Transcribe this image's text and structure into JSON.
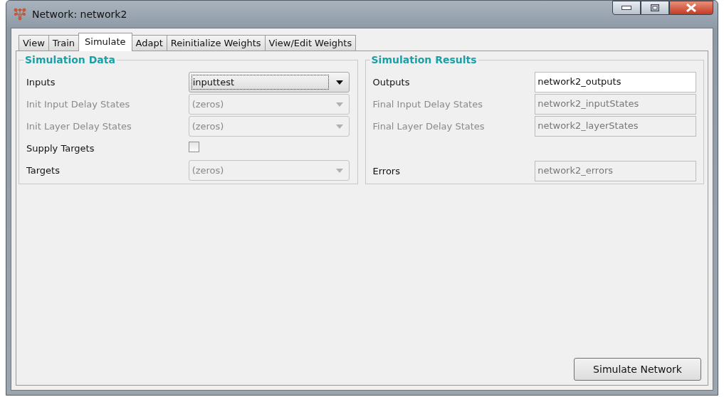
{
  "window": {
    "title": "Network: network2"
  },
  "tabs": [
    {
      "label": "View",
      "selected": false
    },
    {
      "label": "Train",
      "selected": false
    },
    {
      "label": "Simulate",
      "selected": true
    },
    {
      "label": "Adapt",
      "selected": false
    },
    {
      "label": "Reinitialize Weights",
      "selected": false
    },
    {
      "label": "View/Edit Weights",
      "selected": false
    }
  ],
  "simulation_data": {
    "title": "Simulation Data",
    "rows": [
      {
        "kind": "dropdown",
        "label": "Inputs",
        "label_disabled": false,
        "value": "inputtest",
        "disabled": false
      },
      {
        "kind": "dropdown",
        "label": "Init Input Delay States",
        "label_disabled": true,
        "value": "(zeros)",
        "disabled": true
      },
      {
        "kind": "dropdown",
        "label": "Init Layer Delay States",
        "label_disabled": true,
        "value": "(zeros)",
        "disabled": true
      },
      {
        "kind": "checkbox",
        "label": "Supply Targets",
        "label_disabled": false,
        "checked": false
      },
      {
        "kind": "dropdown",
        "label": "Targets",
        "label_disabled": false,
        "value": "(zeros)",
        "disabled": true
      }
    ]
  },
  "simulation_results": {
    "title": "Simulation Results",
    "rows": [
      {
        "label": "Outputs",
        "label_disabled": false,
        "value": "network2_outputs",
        "disabled": false
      },
      {
        "label": "Final Input Delay States",
        "label_disabled": true,
        "value": "network2_inputStates",
        "disabled": true
      },
      {
        "label": "Final Layer Delay States",
        "label_disabled": true,
        "value": "network2_layerStates",
        "disabled": true
      },
      {
        "label": "Errors",
        "label_disabled": false,
        "value": "network2_errors",
        "disabled": true
      }
    ]
  },
  "simulate_button": "Simulate Network"
}
